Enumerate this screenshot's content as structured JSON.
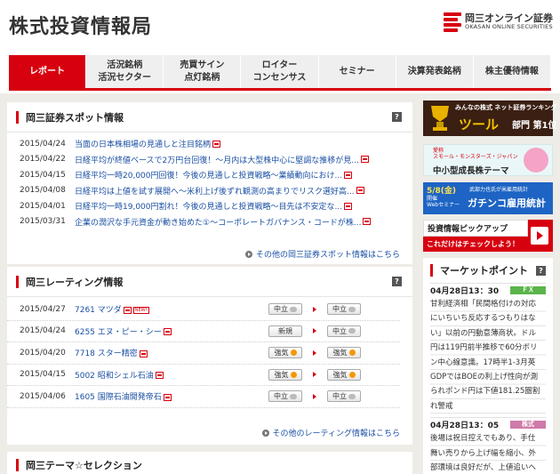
{
  "header": {
    "title": "株式投資情報局",
    "logo_jp": "岡三オンライン証券",
    "logo_en": "OKASAN ONLINE SECURITIES"
  },
  "nav": [
    {
      "label": "レポート",
      "active": true
    },
    {
      "label": "活況銘柄\n活況セクター",
      "active": false
    },
    {
      "label": "売買サイン\n点灯銘柄",
      "active": false
    },
    {
      "label": "ロイター\nコンセンサス",
      "active": false
    },
    {
      "label": "セミナー",
      "active": false
    },
    {
      "label": "決算発表銘柄",
      "active": false
    },
    {
      "label": "株主優待情報",
      "active": false
    }
  ],
  "spot": {
    "title": "岡三証券スポット情報",
    "items": [
      {
        "date": "2015/04/24",
        "title": "当面の日本株相場の見通しと注目銘柄"
      },
      {
        "date": "2015/04/22",
        "title": "日経平均が終値ベースで2万円台回復！～月内は大型株中心に堅調な推移が見..."
      },
      {
        "date": "2015/04/15",
        "title": "日経平均一時20,000円回復！今後の見通しと投資戦略～業績動向におけ..."
      },
      {
        "date": "2015/04/08",
        "title": "日経平均は上値を試す展開へ～米利上げ後ずれ観測の高まりでリスク選好高..."
      },
      {
        "date": "2015/04/01",
        "title": "日経平均一時19,000円割れ！今後の見通しと投資戦略～目先は不安定な..."
      },
      {
        "date": "2015/03/31",
        "title": "企業の潤沢な手元資金が動き始めた①～コーポレートガバナンス・コードが株..."
      }
    ],
    "more": "その他の岡三証券スポット情報はこちら"
  },
  "rating": {
    "title": "岡三レーティング情報",
    "new_badge": "NEW!",
    "items": [
      {
        "date": "2015/04/27",
        "title": "7261 マツダ",
        "new": true,
        "from": "中立",
        "from_icon": "cloud-icon",
        "to": "中立",
        "to_icon": "cloud-icon"
      },
      {
        "date": "2015/04/24",
        "title": "6255 エヌ・ピー・シー",
        "new": false,
        "from": "新規",
        "from_icon": "",
        "to": "中立",
        "to_icon": "cloud-icon"
      },
      {
        "date": "2015/04/20",
        "title": "7718 スター精密",
        "new": false,
        "from": "強気",
        "from_icon": "sun-icon",
        "to": "強気",
        "to_icon": "sun-icon"
      },
      {
        "date": "2015/04/15",
        "title": "5002 昭和シェル石油",
        "new": false,
        "from": "強気",
        "from_icon": "sun-icon",
        "to": "強気",
        "to_icon": "sun-icon"
      },
      {
        "date": "2015/04/06",
        "title": "1605 国際石油開発帝石",
        "new": false,
        "from": "中立",
        "from_icon": "cloud-icon",
        "to": "中立",
        "to_icon": "cloud-icon"
      }
    ],
    "more": "その他のレーティング情報はこちら"
  },
  "theme": {
    "title": "岡三テーマ☆セレクション"
  },
  "banners": {
    "ranking_top": "みんなの株式 ネット証券ランキング",
    "ranking_main": "ツール",
    "ranking_sub": "部門 第1位",
    "monsters_top": "愛称\nスモール・モンスターズ・ジャパン",
    "monsters_main": "中小型成長株テーマ",
    "seminar_date": "5/8(金)",
    "seminar_sub": "開催\nWebセミナー",
    "seminar_top": "武部力也氏が米雇用統計",
    "seminar_main": "ガチンコ雇用統計",
    "pickup_title": "投資情報ピックアップ",
    "pickup_sub": "これだけはチェックしよう！"
  },
  "market": {
    "title": "マーケットポイント",
    "items": [
      {
        "time": "04月28日13：30",
        "tag": "ＦＸ",
        "tag_color": "#5ab44a",
        "body": "甘利経済相「民間格付けの対応\nにいちいち反応するつもりはな\nい」以前の円動意薄商状。ドル\n円は119円前半推移で60分ボリ\nン中心線意識。17時半1-3月英\nGDPではBOEの利上げ性向が測\nられポンド円は下値181.25圏割\nれ警戒"
      },
      {
        "time": "04月28日13：05",
        "tag": "株式",
        "tag_color": "#cf7aa8",
        "body": "後場は祝日控えでもあり、手仕\n舞い売りから上げ幅を縮小、外\n部環境は良好だが、上値追いへ"
      }
    ]
  }
}
